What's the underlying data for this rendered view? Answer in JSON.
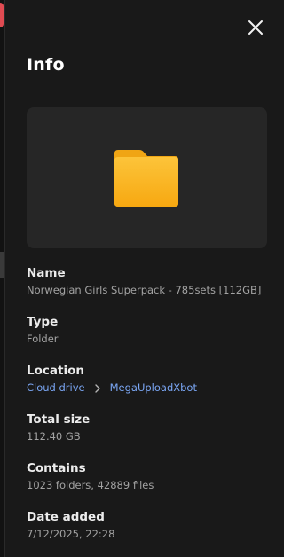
{
  "panel": {
    "title": "Info",
    "colors": {
      "background": "#191919",
      "preview_bg": "#262626",
      "folder": "#f9b120",
      "link": "#7ba7f5",
      "accent_left": "#e04b52"
    },
    "icons": {
      "close": "close-icon",
      "preview": "folder-icon",
      "separator": "chevron-right-icon"
    }
  },
  "fields": {
    "name": {
      "label": "Name",
      "value": "Norwegian Girls Superpack - 785sets [112GB]"
    },
    "type": {
      "label": "Type",
      "value": "Folder"
    },
    "location": {
      "label": "Location",
      "path": [
        "Cloud drive",
        "MegaUploadXbot"
      ]
    },
    "total_size": {
      "label": "Total size",
      "value": "112.40 GB"
    },
    "contains": {
      "label": "Contains",
      "value": "1023 folders, 42889 files"
    },
    "date_added": {
      "label": "Date added",
      "value": "7/12/2025, 22:28"
    }
  }
}
